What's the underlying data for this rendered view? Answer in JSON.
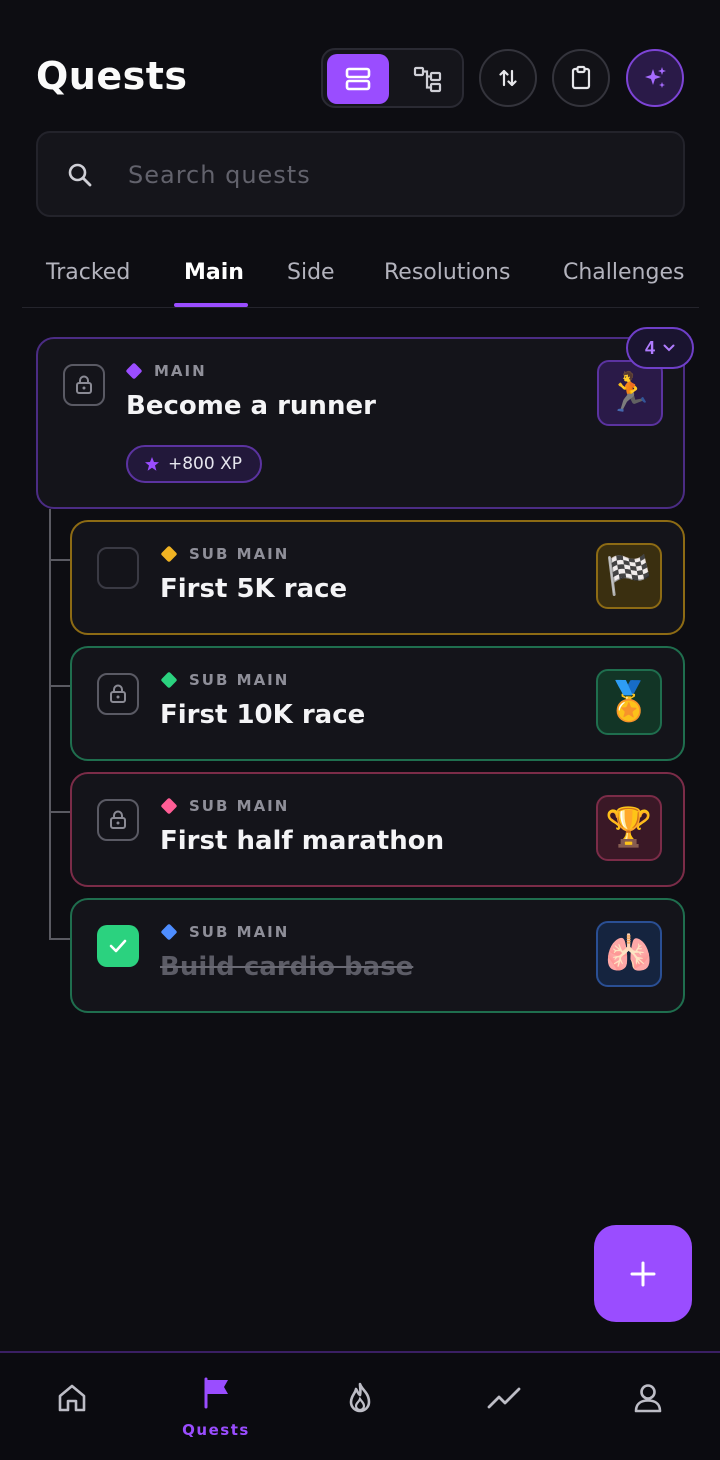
{
  "header": {
    "title": "Quests",
    "view_toggle": {
      "active": "list",
      "options": [
        "list-view",
        "tree-view"
      ]
    },
    "actions": [
      "sort-icon",
      "clipboard-icon",
      "sparkle-icon"
    ]
  },
  "search": {
    "placeholder": "Search quests",
    "value": ""
  },
  "tabs": [
    {
      "label": "Tracked",
      "active": false
    },
    {
      "label": "Main",
      "active": true
    },
    {
      "label": "Side",
      "active": false
    },
    {
      "label": "Resolutions",
      "active": false
    },
    {
      "label": "Challenges",
      "active": false
    }
  ],
  "main_quest": {
    "tag": "MAIN",
    "title": "Become a runner",
    "xp": "+800 XP",
    "emoji": "🏃",
    "sub_count": "4",
    "locked": true,
    "accent": "#9a4dff"
  },
  "sub_quests": [
    {
      "tag": "SUB MAIN",
      "title": "First 5K race",
      "emoji": "🏁",
      "status": "open",
      "accent": "#f0b323"
    },
    {
      "tag": "SUB MAIN",
      "title": "First 10K race",
      "emoji": "🏅",
      "status": "locked",
      "accent": "#2bd27f"
    },
    {
      "tag": "SUB MAIN",
      "title": "First half marathon",
      "emoji": "🏆",
      "status": "locked",
      "accent": "#ff5d95"
    },
    {
      "tag": "SUB MAIN",
      "title": "Build cardio base",
      "emoji": "🫁",
      "status": "completed",
      "accent": "#4e8dff"
    }
  ],
  "fab": {
    "icon": "plus-icon"
  },
  "bottom_nav": [
    {
      "icon": "home-icon",
      "label": "",
      "active": false
    },
    {
      "icon": "flag-icon",
      "label": "Quests",
      "active": true
    },
    {
      "icon": "flame-icon",
      "label": "",
      "active": false
    },
    {
      "icon": "trend-icon",
      "label": "",
      "active": false
    },
    {
      "icon": "profile-icon",
      "label": "",
      "active": false
    }
  ],
  "colors": {
    "background": "#0d0d12",
    "accent": "#9a4dff",
    "success": "#2bd27f"
  }
}
